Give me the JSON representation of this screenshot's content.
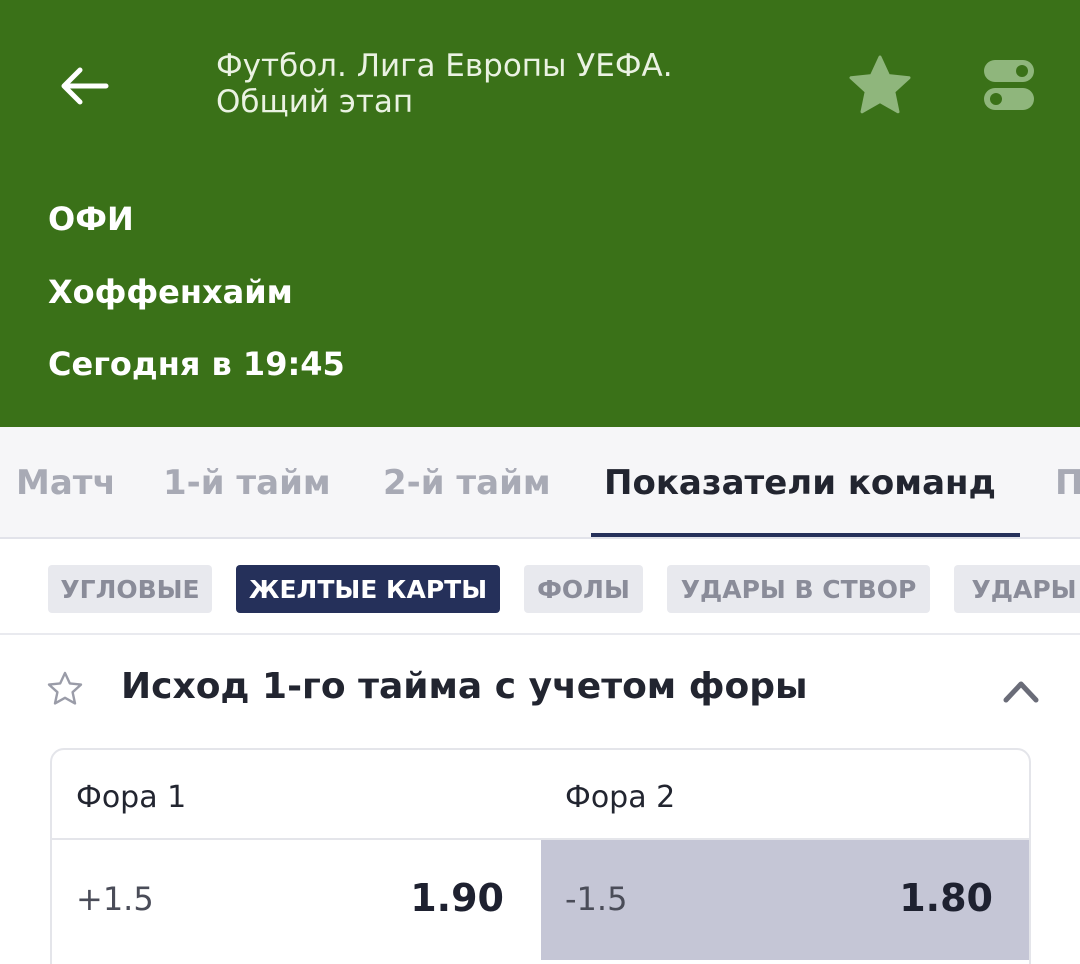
{
  "header": {
    "league_line1": "Футбол. Лига Европы УЕФА.",
    "league_line2": "Общий этап",
    "team1": "ОФИ",
    "team2": "Хоффенхайм",
    "time": "Сегодня в 19:45",
    "bg_color": "#3a7118",
    "icons": {
      "back": "arrow-left-icon",
      "favorite": "star-icon",
      "settings": "toggle-icon"
    }
  },
  "tabs": [
    {
      "label": "Матч",
      "active": false
    },
    {
      "label": "1-й тайм",
      "active": false
    },
    {
      "label": "2-й тайм",
      "active": false
    },
    {
      "label": "Показатели команд",
      "active": true
    },
    {
      "label": "П",
      "active": false
    }
  ],
  "chips": [
    {
      "label": "УГЛОВЫЕ",
      "active": false
    },
    {
      "label": "ЖЕЛТЫЕ КАРТЫ",
      "active": true
    },
    {
      "label": "ФОЛЫ",
      "active": false
    },
    {
      "label": "УДАРЫ В СТВОР",
      "active": false
    },
    {
      "label": "УДАРЫ",
      "active": false
    }
  ],
  "market": {
    "title": "Исход 1-го тайма с учетом форы",
    "columns": [
      "Фора 1",
      "Фора 2"
    ],
    "outcomes": [
      {
        "handicap": "+1.5",
        "odds": "1.90",
        "selected": false
      },
      {
        "handicap": "-1.5",
        "odds": "1.80",
        "selected": true
      }
    ]
  },
  "colors": {
    "accent": "#25305a",
    "selected_cell": "#c5c6d6"
  }
}
